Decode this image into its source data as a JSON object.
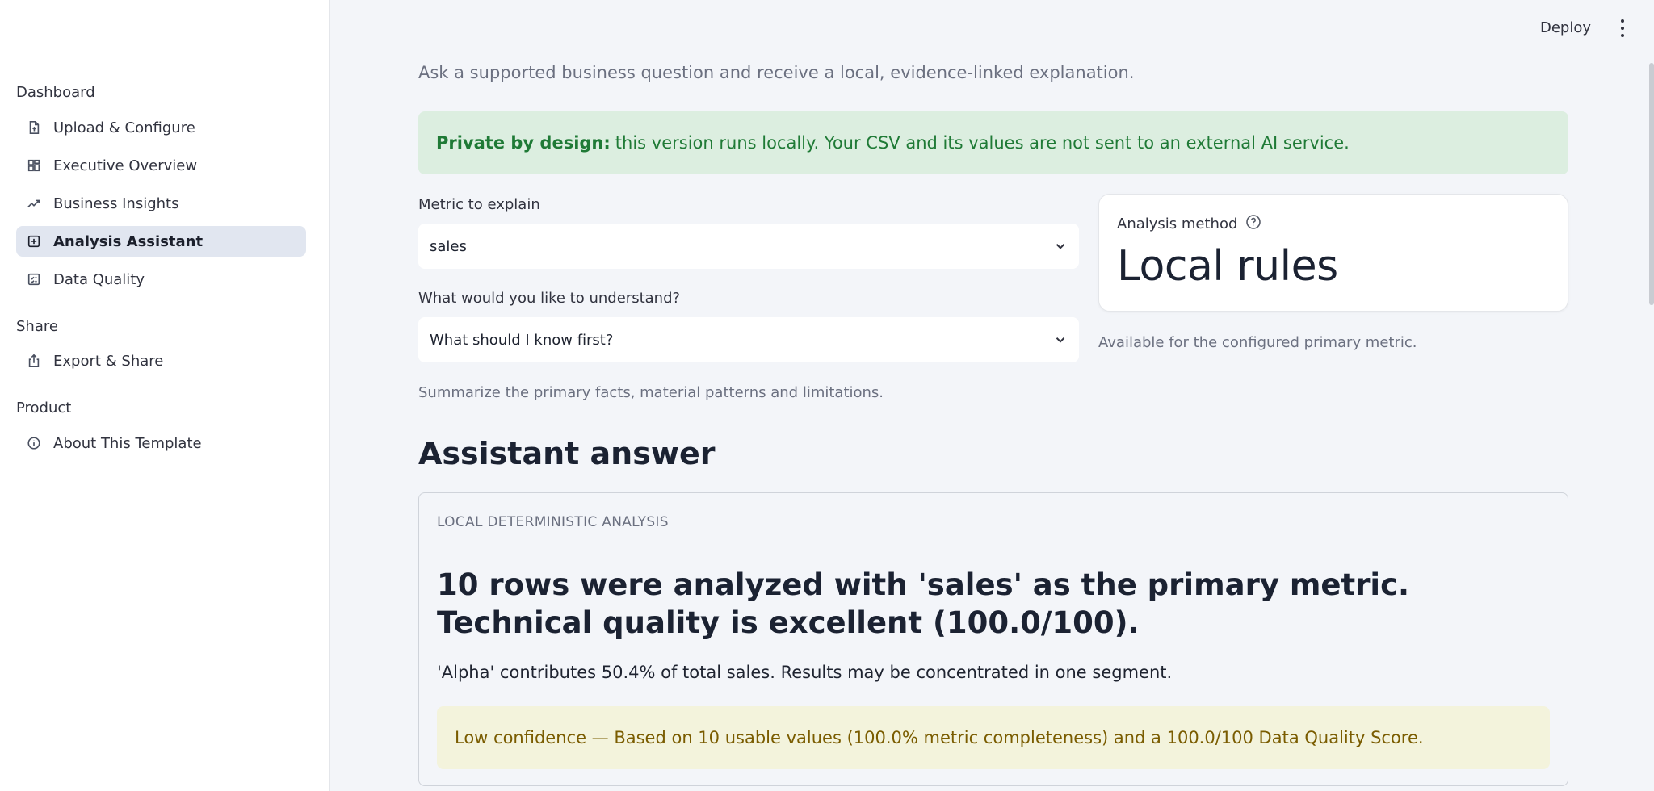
{
  "sidebar": {
    "sections": [
      {
        "label": "Dashboard"
      },
      {
        "label": "Share"
      },
      {
        "label": "Product"
      }
    ],
    "items": [
      {
        "label": "Upload & Configure",
        "icon": "file-upload-icon"
      },
      {
        "label": "Executive Overview",
        "icon": "dashboard-icon"
      },
      {
        "label": "Business Insights",
        "icon": "trend-icon"
      },
      {
        "label": "Analysis Assistant",
        "icon": "assistant-icon",
        "active": true
      },
      {
        "label": "Data Quality",
        "icon": "checklist-icon"
      },
      {
        "label": "Export & Share",
        "icon": "share-icon"
      },
      {
        "label": "About This Template",
        "icon": "info-icon"
      }
    ]
  },
  "header": {
    "deploy_label": "Deploy"
  },
  "main": {
    "subtitle": "Ask a supported business question and receive a local, evidence-linked explanation.",
    "privacy": {
      "bold": "Private by design:",
      "text": "this version runs locally. Your CSV and its values are not sent to an external AI service."
    },
    "metric_select": {
      "label": "Metric to explain",
      "value": "sales"
    },
    "question_select": {
      "label": "What would you like to understand?",
      "value": "What should I know first?"
    },
    "helper": "Summarize the primary facts, material patterns and limitations.",
    "analysis_method": {
      "label": "Analysis method",
      "value": "Local rules",
      "caption": "Available for the configured primary metric."
    },
    "answer": {
      "heading": "Assistant answer",
      "tag": "LOCAL DETERMINISTIC ANALYSIS",
      "title": "10 rows were analyzed with 'sales' as the primary metric. Technical quality is excellent (100.0/100).",
      "body": "'Alpha' contributes 50.4% of total sales. Results may be concentrated in one segment.",
      "confidence": "Low confidence — Based on 10 usable values (100.0% metric completeness) and a 100.0/100 Data Quality Score."
    }
  },
  "colors": {
    "active_nav_bg": "#e1e6f0",
    "privacy_bg": "#dceee0",
    "privacy_text": "#1f7a36",
    "confidence_bg": "#f3f3dc",
    "confidence_text": "#7a5c00"
  }
}
